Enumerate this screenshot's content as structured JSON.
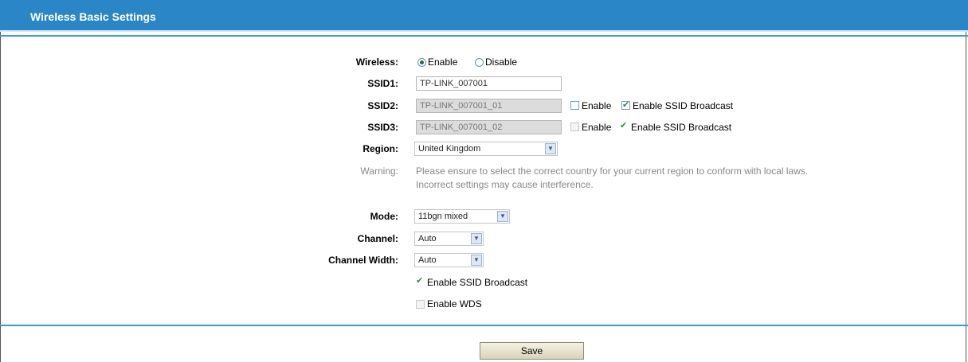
{
  "header": {
    "title": "Wireless Basic Settings"
  },
  "form": {
    "wireless": {
      "label": "Wireless:",
      "enable": "Enable",
      "disable": "Disable",
      "selected": "Enable"
    },
    "ssid1": {
      "label": "SSID1:",
      "value": "TP-LINK_007001"
    },
    "ssid2": {
      "label": "SSID2:",
      "value": "TP-LINK_007001_01",
      "enable_label": "Enable",
      "enable_checked": false,
      "broadcast_label": "Enable SSID Broadcast",
      "broadcast_checked": true
    },
    "ssid3": {
      "label": "SSID3:",
      "value": "TP-LINK_007001_02",
      "enable_label": "Enable",
      "enable_checked": false,
      "broadcast_label": "Enable SSID Broadcast",
      "broadcast_checked": true
    },
    "region": {
      "label": "Region:",
      "value": "United Kingdom"
    },
    "warning": {
      "label": "Warning:",
      "line1": "Please ensure to select the correct country for your current region to conform with local laws.",
      "line2": "Incorrect settings may cause interference."
    },
    "mode": {
      "label": "Mode:",
      "value": "11bgn mixed"
    },
    "channel": {
      "label": "Channel:",
      "value": "Auto"
    },
    "channel_width": {
      "label": "Channel Width:",
      "value": "Auto"
    },
    "ssid_broadcast": {
      "label": "Enable SSID Broadcast",
      "checked": true
    },
    "wds": {
      "label": "Enable WDS",
      "checked": false
    }
  },
  "buttons": {
    "save": "Save"
  },
  "colors": {
    "header_bg": "#2a86c6",
    "rule": "#3a9ad6",
    "check": "#3a8a3a"
  }
}
